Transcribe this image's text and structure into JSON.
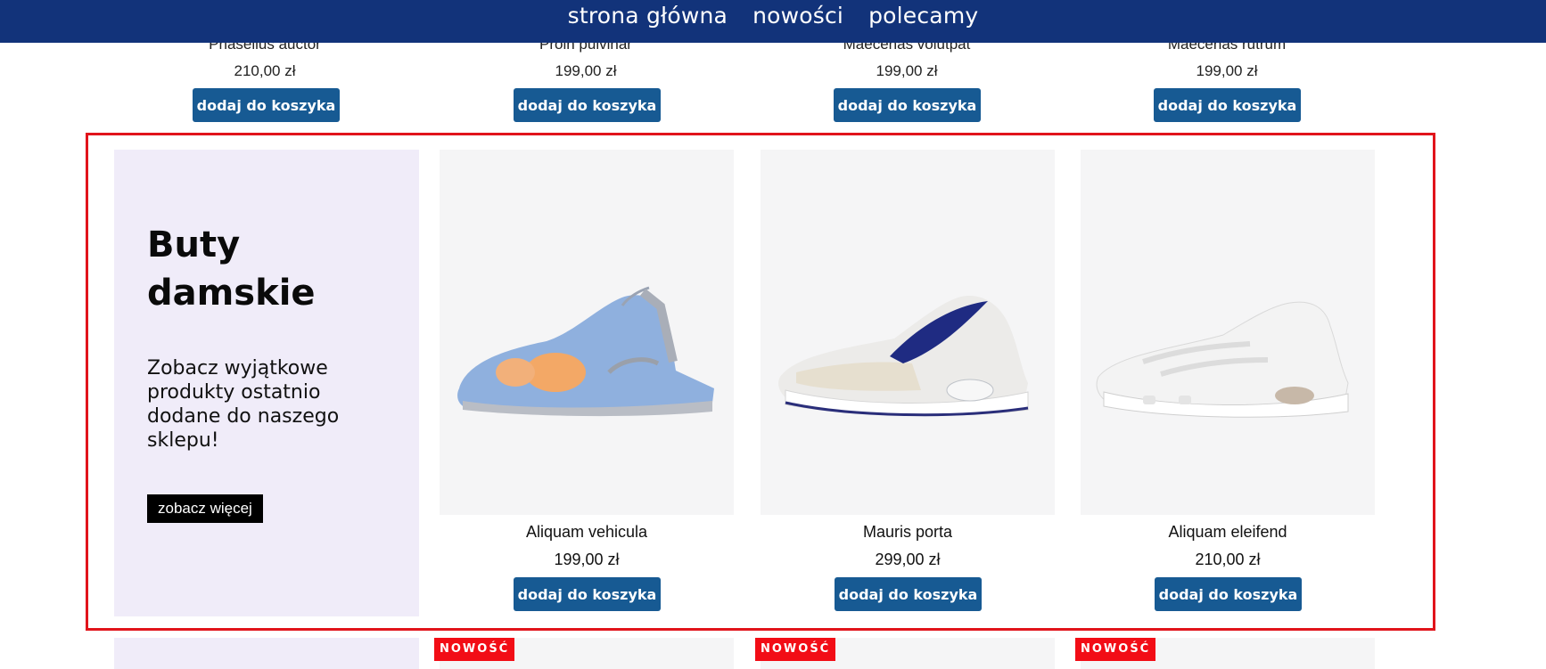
{
  "nav": {
    "items": [
      "strona główna",
      "nowości",
      "polecamy"
    ]
  },
  "previous_row": [
    {
      "name": "Phasellus auctor",
      "price": "210,00 zł",
      "button": "dodaj do koszyka"
    },
    {
      "name": "Proin pulvinar",
      "price": "199,00 zł",
      "button": "dodaj do koszyka"
    },
    {
      "name": "Maecenas volutpat",
      "price": "199,00 zł",
      "button": "dodaj do koszyka"
    },
    {
      "name": "Maecenas rutrum",
      "price": "199,00 zł",
      "button": "dodaj do koszyka"
    }
  ],
  "promo": {
    "title": "Buty damskie",
    "text": "Zobacz wyjątkowe produkty ostatnio dodane do naszego sklepu!",
    "button": "zobacz więcej"
  },
  "products": [
    {
      "name": "Aliquam vehicula",
      "price": "199,00 zł",
      "button": "dodaj do koszyka",
      "icon": "sneaker-blue-orange"
    },
    {
      "name": "Mauris porta",
      "price": "299,00 zł",
      "button": "dodaj do koszyka",
      "icon": "sneaker-white-navy"
    },
    {
      "name": "Aliquam eleifend",
      "price": "210,00 zł",
      "button": "dodaj do koszyka",
      "icon": "sneaker-white"
    }
  ],
  "next_row": {
    "badges": [
      "NOWOŚĆ",
      "NOWOŚĆ",
      "NOWOŚĆ"
    ]
  },
  "colors": {
    "nav_bg": "#12337a",
    "button_bg": "#175a93",
    "highlight_border": "#e1141b",
    "promo_bg": "#f0ecf9",
    "badge_bg": "#f20d16"
  }
}
